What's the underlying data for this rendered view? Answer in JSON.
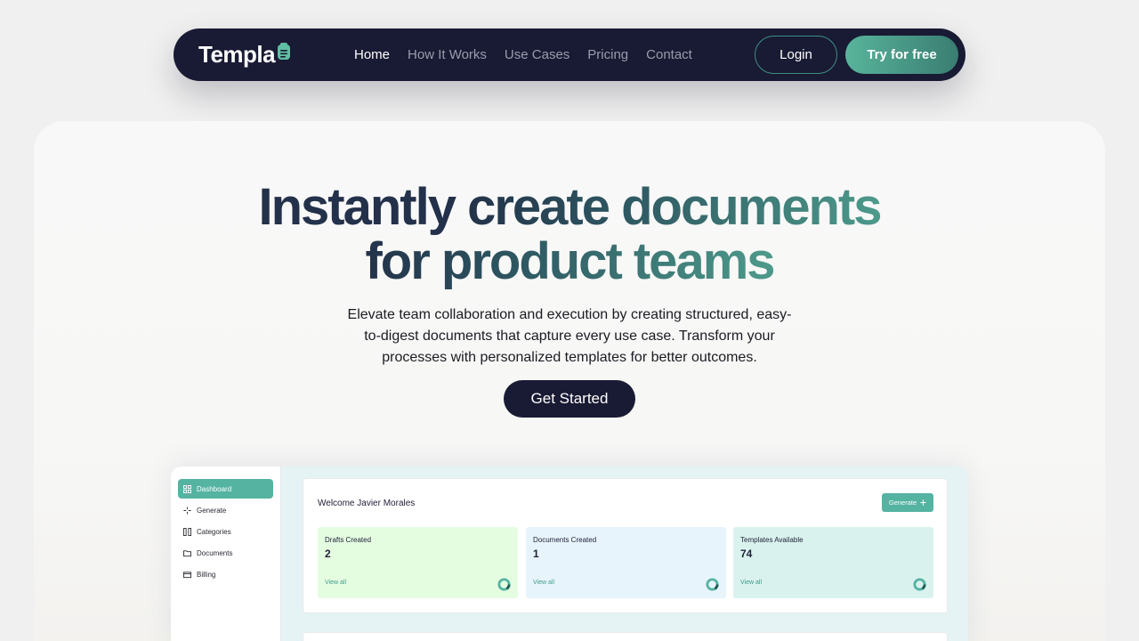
{
  "nav": {
    "logo": "Templa",
    "links": [
      {
        "label": "Home",
        "active": true
      },
      {
        "label": "How It Works",
        "active": false
      },
      {
        "label": "Use Cases",
        "active": false
      },
      {
        "label": "Pricing",
        "active": false
      },
      {
        "label": "Contact",
        "active": false
      }
    ],
    "login_label": "Login",
    "try_label": "Try for free"
  },
  "hero": {
    "headline_part1": "Instantly ",
    "headline_part2": "create documents",
    "headline_part3": "for product teams",
    "subtitle": "Elevate team collaboration and execution by creating structured, easy-to-digest documents that capture every use case. Transform your processes with personalized templates for better outcomes.",
    "cta_label": "Get Started"
  },
  "dashboard": {
    "sidebar": [
      {
        "label": "Dashboard",
        "icon": "grid-icon",
        "active": true
      },
      {
        "label": "Generate",
        "icon": "sparkle-icon",
        "active": false
      },
      {
        "label": "Categories",
        "icon": "columns-icon",
        "active": false
      },
      {
        "label": "Documents",
        "icon": "folder-icon",
        "active": false
      },
      {
        "label": "Billing",
        "icon": "card-icon",
        "active": false
      }
    ],
    "welcome": "Welcome Javier Morales",
    "generate_label": "Generate",
    "stats": [
      {
        "label": "Drafts Created",
        "value": "2",
        "link": "View all",
        "color": "#e4fde1"
      },
      {
        "label": "Documents Created",
        "value": "1",
        "link": "View all",
        "color": "#e7f4fb"
      },
      {
        "label": "Templates Available",
        "value": "74",
        "link": "View all",
        "color": "#d9f2ee"
      }
    ]
  },
  "colors": {
    "nav_bg": "#191a33",
    "accent": "#55b3a2"
  }
}
